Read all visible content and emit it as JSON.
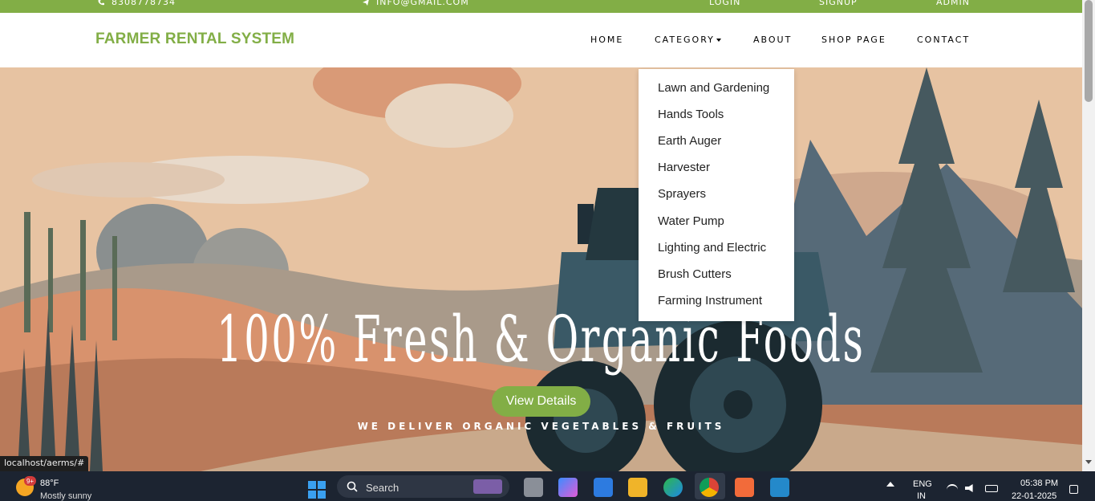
{
  "topbar": {
    "phone": "8308778734",
    "email": "INFO@GMAIL.COM",
    "login": "LOGIN",
    "signup": "SIGNUP",
    "admin": "ADMIN",
    "color": "#82ae46"
  },
  "navbar": {
    "brand": "FARMER RENTAL SYSTEM",
    "items": [
      "HOME",
      "CATEGORY",
      "ABOUT",
      "SHOP PAGE",
      "CONTACT"
    ]
  },
  "dropdown": {
    "items": [
      "Lawn and Gardening",
      "Hands Tools",
      "Earth Auger",
      "Harvester",
      "Sprayers",
      "Water Pump",
      "Lighting and Electric",
      "Brush Cutters",
      "Farming Instrument"
    ]
  },
  "hero": {
    "title": "100% Fresh & Organic Foods",
    "subtitle": "WE DELIVER ORGANIC VEGETABLES & FRUITS",
    "button": "View Details"
  },
  "status_url": "localhost/aerms/#",
  "taskbar": {
    "weather_temp": "88°F",
    "weather_desc": "Mostly sunny",
    "weather_badge": "9+",
    "search_placeholder": "Search",
    "lang": "ENG",
    "region": "IN",
    "time": "05:38 PM",
    "date": "22-01-2025"
  }
}
